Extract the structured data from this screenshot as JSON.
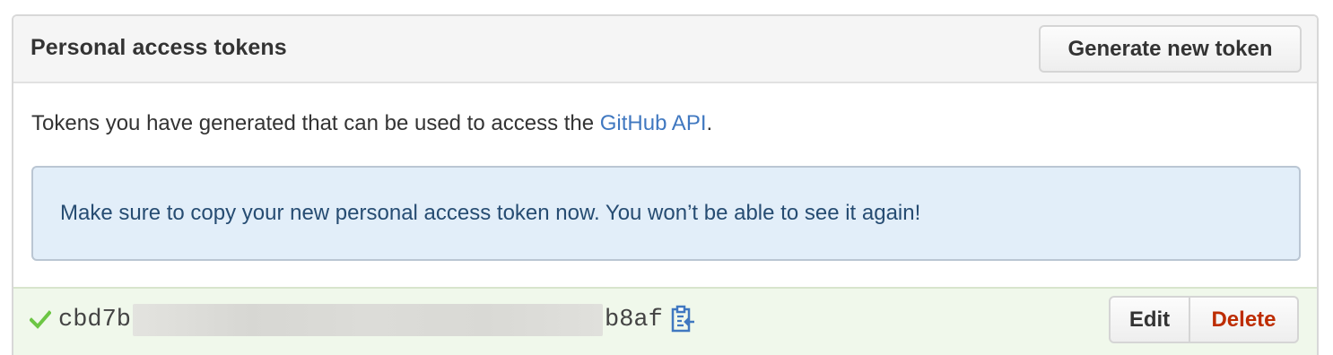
{
  "panel": {
    "title": "Personal access tokens",
    "generate_button_label": "Generate new token"
  },
  "intro": {
    "text_before_link": "Tokens you have generated that can be used to access the ",
    "link_text": "GitHub API",
    "text_after_link": "."
  },
  "flash": {
    "message": "Make sure to copy your new personal access token now. You won’t be able to see it again!"
  },
  "token": {
    "prefix": "cbd7b",
    "suffix": "b8af",
    "status_icon": "check-icon",
    "copy_icon": "clipboard-icon",
    "edit_label": "Edit",
    "delete_label": "Delete"
  },
  "colors": {
    "link": "#4078c0",
    "flash_bg": "#e2eef9",
    "flash_text": "#264c72",
    "token_row_bg": "#f0f8eb",
    "check_green": "#6cc644",
    "delete_red": "#bd2c00"
  }
}
